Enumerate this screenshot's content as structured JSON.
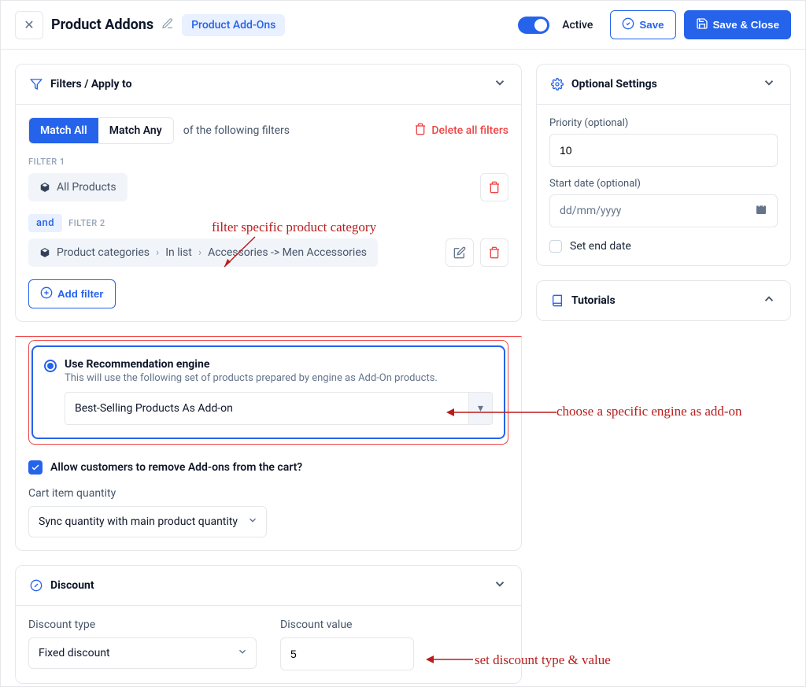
{
  "header": {
    "title": "Product Addons",
    "badge": "Product Add-Ons",
    "active_label": "Active",
    "save_label": "Save",
    "save_close_label": "Save & Close"
  },
  "filters": {
    "header": "Filters / Apply to",
    "match_all": "Match All",
    "match_any": "Match Any",
    "following_text": "of the following filters",
    "delete_all": "Delete all filters",
    "filter1_label": "FILTER 1",
    "filter1_chip": "All Products",
    "and_label": "and",
    "filter2_label": "FILTER 2",
    "filter2_parts": [
      "Product categories",
      "In list",
      "Accessories -> Men Accessories"
    ],
    "add_filter": "Add filter"
  },
  "engine": {
    "title": "Use Recommendation engine",
    "desc": "This will use the following set of products prepared by engine as Add-On products.",
    "selected": "Best-Selling Products As Add-on"
  },
  "allow_remove": {
    "label": "Allow customers to remove Add-ons from the cart?"
  },
  "cart_qty": {
    "label": "Cart item quantity",
    "value": "Sync quantity with main product quantity"
  },
  "discount": {
    "header": "Discount",
    "type_label": "Discount type",
    "type_value": "Fixed discount",
    "value_label": "Discount value",
    "value": "5"
  },
  "optional": {
    "header": "Optional Settings",
    "priority_label": "Priority (optional)",
    "priority_value": "10",
    "start_label": "Start date (optional)",
    "start_placeholder": "dd/mm/yyyy",
    "end_label": "Set end date"
  },
  "tutorials": {
    "header": "Tutorials"
  },
  "annotations": {
    "filter_cat": "filter specific product category",
    "engine": "choose a specific engine as add-on",
    "discount": "set discount type & value"
  }
}
